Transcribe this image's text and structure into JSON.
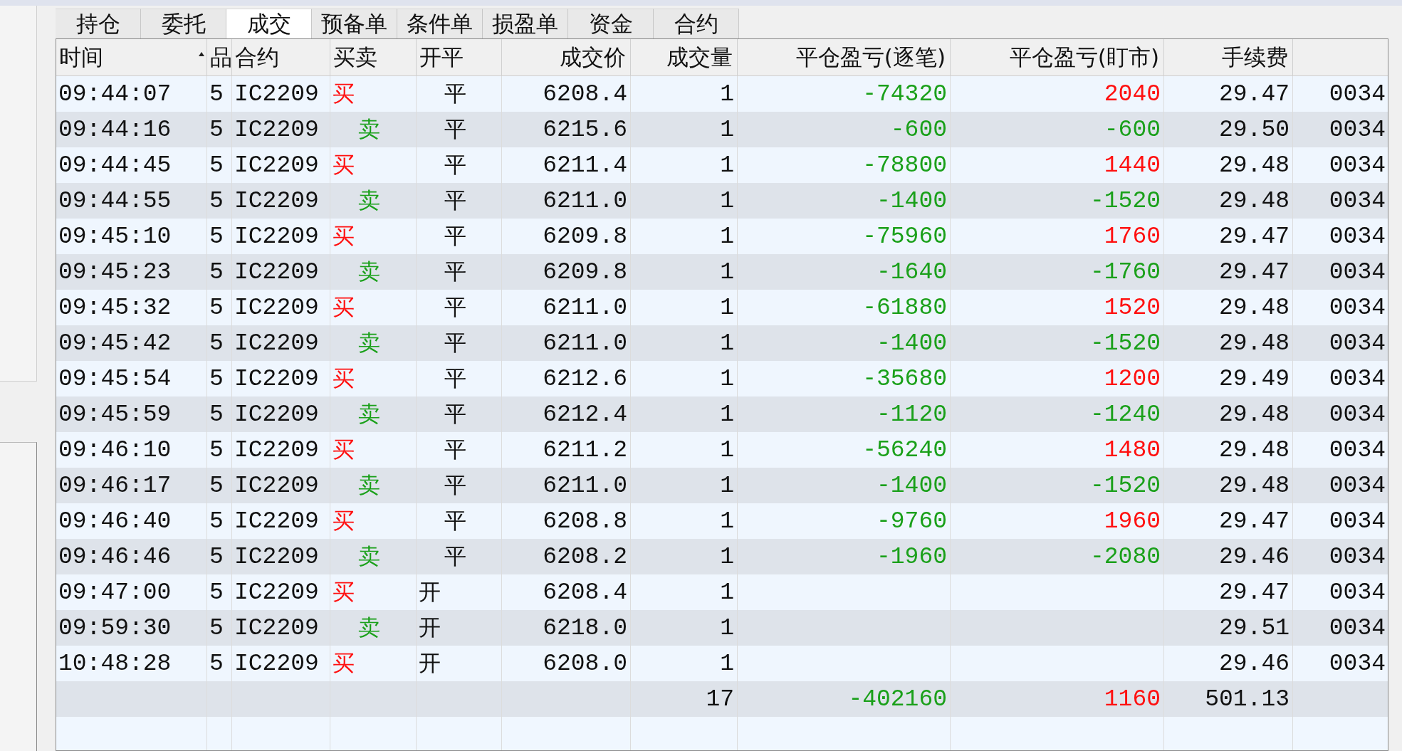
{
  "tabs": [
    {
      "label": "持仓",
      "selected": false
    },
    {
      "label": "委托",
      "selected": false
    },
    {
      "label": "成交",
      "selected": true
    },
    {
      "label": "预备单",
      "selected": false
    },
    {
      "label": "条件单",
      "selected": false
    },
    {
      "label": "损盈单",
      "selected": false
    },
    {
      "label": "资金",
      "selected": false
    },
    {
      "label": "合约",
      "selected": false
    }
  ],
  "table": {
    "columns": [
      {
        "label": "时间",
        "sorted": true
      },
      {
        "label": "品",
        "sorted": false
      },
      {
        "label": "合约",
        "sorted": false
      },
      {
        "label": "买卖",
        "sorted": false
      },
      {
        "label": "开平",
        "sorted": false
      },
      {
        "label": "成交价",
        "sorted": false
      },
      {
        "label": "成交量",
        "sorted": false
      },
      {
        "label": "平仓盈亏(逐笔)",
        "sorted": false
      },
      {
        "label": "平仓盈亏(盯市)",
        "sorted": false
      },
      {
        "label": "手续费",
        "sorted": false
      }
    ],
    "rows": [
      {
        "time": "09:44:07",
        "column_2": "5",
        "contract": "IC2209",
        "side": {
          "kind": "buy",
          "text": "买"
        },
        "open_close": {
          "kind": "close",
          "text": "平"
        },
        "price": "6208.4",
        "volume": "1",
        "pnl_trade": {
          "kind": "loss",
          "text": "-74320"
        },
        "pnl_mark": {
          "kind": "profit",
          "text": "2040"
        },
        "fee": "29.47",
        "column_11": "0034"
      },
      {
        "time": "09:44:16",
        "column_2": "5",
        "contract": "IC2209",
        "side": {
          "kind": "sell",
          "text": "卖"
        },
        "open_close": {
          "kind": "close",
          "text": "平"
        },
        "price": "6215.6",
        "volume": "1",
        "pnl_trade": {
          "kind": "loss",
          "text": "-600"
        },
        "pnl_mark": {
          "kind": "loss",
          "text": "-600"
        },
        "fee": "29.50",
        "column_11": "0034"
      },
      {
        "time": "09:44:45",
        "column_2": "5",
        "contract": "IC2209",
        "side": {
          "kind": "buy",
          "text": "买"
        },
        "open_close": {
          "kind": "close",
          "text": "平"
        },
        "price": "6211.4",
        "volume": "1",
        "pnl_trade": {
          "kind": "loss",
          "text": "-78800"
        },
        "pnl_mark": {
          "kind": "profit",
          "text": "1440"
        },
        "fee": "29.48",
        "column_11": "0034"
      },
      {
        "time": "09:44:55",
        "column_2": "5",
        "contract": "IC2209",
        "side": {
          "kind": "sell",
          "text": "卖"
        },
        "open_close": {
          "kind": "close",
          "text": "平"
        },
        "price": "6211.0",
        "volume": "1",
        "pnl_trade": {
          "kind": "loss",
          "text": "-1400"
        },
        "pnl_mark": {
          "kind": "loss",
          "text": "-1520"
        },
        "fee": "29.48",
        "column_11": "0034"
      },
      {
        "time": "09:45:10",
        "column_2": "5",
        "contract": "IC2209",
        "side": {
          "kind": "buy",
          "text": "买"
        },
        "open_close": {
          "kind": "close",
          "text": "平"
        },
        "price": "6209.8",
        "volume": "1",
        "pnl_trade": {
          "kind": "loss",
          "text": "-75960"
        },
        "pnl_mark": {
          "kind": "profit",
          "text": "1760"
        },
        "fee": "29.47",
        "column_11": "0034"
      },
      {
        "time": "09:45:23",
        "column_2": "5",
        "contract": "IC2209",
        "side": {
          "kind": "sell",
          "text": "卖"
        },
        "open_close": {
          "kind": "close",
          "text": "平"
        },
        "price": "6209.8",
        "volume": "1",
        "pnl_trade": {
          "kind": "loss",
          "text": "-1640"
        },
        "pnl_mark": {
          "kind": "loss",
          "text": "-1760"
        },
        "fee": "29.47",
        "column_11": "0034"
      },
      {
        "time": "09:45:32",
        "column_2": "5",
        "contract": "IC2209",
        "side": {
          "kind": "buy",
          "text": "买"
        },
        "open_close": {
          "kind": "close",
          "text": "平"
        },
        "price": "6211.0",
        "volume": "1",
        "pnl_trade": {
          "kind": "loss",
          "text": "-61880"
        },
        "pnl_mark": {
          "kind": "profit",
          "text": "1520"
        },
        "fee": "29.48",
        "column_11": "0034"
      },
      {
        "time": "09:45:42",
        "column_2": "5",
        "contract": "IC2209",
        "side": {
          "kind": "sell",
          "text": "卖"
        },
        "open_close": {
          "kind": "close",
          "text": "平"
        },
        "price": "6211.0",
        "volume": "1",
        "pnl_trade": {
          "kind": "loss",
          "text": "-1400"
        },
        "pnl_mark": {
          "kind": "loss",
          "text": "-1520"
        },
        "fee": "29.48",
        "column_11": "0034"
      },
      {
        "time": "09:45:54",
        "column_2": "5",
        "contract": "IC2209",
        "side": {
          "kind": "buy",
          "text": "买"
        },
        "open_close": {
          "kind": "close",
          "text": "平"
        },
        "price": "6212.6",
        "volume": "1",
        "pnl_trade": {
          "kind": "loss",
          "text": "-35680"
        },
        "pnl_mark": {
          "kind": "profit",
          "text": "1200"
        },
        "fee": "29.49",
        "column_11": "0034"
      },
      {
        "time": "09:45:59",
        "column_2": "5",
        "contract": "IC2209",
        "side": {
          "kind": "sell",
          "text": "卖"
        },
        "open_close": {
          "kind": "close",
          "text": "平"
        },
        "price": "6212.4",
        "volume": "1",
        "pnl_trade": {
          "kind": "loss",
          "text": "-1120"
        },
        "pnl_mark": {
          "kind": "loss",
          "text": "-1240"
        },
        "fee": "29.48",
        "column_11": "0034"
      },
      {
        "time": "09:46:10",
        "column_2": "5",
        "contract": "IC2209",
        "side": {
          "kind": "buy",
          "text": "买"
        },
        "open_close": {
          "kind": "close",
          "text": "平"
        },
        "price": "6211.2",
        "volume": "1",
        "pnl_trade": {
          "kind": "loss",
          "text": "-56240"
        },
        "pnl_mark": {
          "kind": "profit",
          "text": "1480"
        },
        "fee": "29.48",
        "column_11": "0034"
      },
      {
        "time": "09:46:17",
        "column_2": "5",
        "contract": "IC2209",
        "side": {
          "kind": "sell",
          "text": "卖"
        },
        "open_close": {
          "kind": "close",
          "text": "平"
        },
        "price": "6211.0",
        "volume": "1",
        "pnl_trade": {
          "kind": "loss",
          "text": "-1400"
        },
        "pnl_mark": {
          "kind": "loss",
          "text": "-1520"
        },
        "fee": "29.48",
        "column_11": "0034"
      },
      {
        "time": "09:46:40",
        "column_2": "5",
        "contract": "IC2209",
        "side": {
          "kind": "buy",
          "text": "买"
        },
        "open_close": {
          "kind": "close",
          "text": "平"
        },
        "price": "6208.8",
        "volume": "1",
        "pnl_trade": {
          "kind": "loss",
          "text": "-9760"
        },
        "pnl_mark": {
          "kind": "profit",
          "text": "1960"
        },
        "fee": "29.47",
        "column_11": "0034"
      },
      {
        "time": "09:46:46",
        "column_2": "5",
        "contract": "IC2209",
        "side": {
          "kind": "sell",
          "text": "卖"
        },
        "open_close": {
          "kind": "close",
          "text": "平"
        },
        "price": "6208.2",
        "volume": "1",
        "pnl_trade": {
          "kind": "loss",
          "text": "-1960"
        },
        "pnl_mark": {
          "kind": "loss",
          "text": "-2080"
        },
        "fee": "29.46",
        "column_11": "0034"
      },
      {
        "time": "09:47:00",
        "column_2": "5",
        "contract": "IC2209",
        "side": {
          "kind": "buy",
          "text": "买"
        },
        "open_close": {
          "kind": "open",
          "text": "开"
        },
        "price": "6208.4",
        "volume": "1",
        "fee": "29.47",
        "column_11": "0034"
      },
      {
        "time": "09:59:30",
        "column_2": "5",
        "contract": "IC2209",
        "side": {
          "kind": "sell",
          "text": "卖"
        },
        "open_close": {
          "kind": "open",
          "text": "开"
        },
        "price": "6218.0",
        "volume": "1",
        "fee": "29.51",
        "column_11": "0034"
      },
      {
        "time": "10:48:28",
        "column_2": "5",
        "contract": "IC2209",
        "side": {
          "kind": "buy",
          "text": "买"
        },
        "open_close": {
          "kind": "open",
          "text": "开"
        },
        "price": "6208.0",
        "volume": "1",
        "fee": "29.46",
        "column_11": "0034"
      }
    ],
    "totals": {
      "volume": "17",
      "pnl_trade": {
        "kind": "loss",
        "text": "-402160"
      },
      "pnl_mark": {
        "kind": "profit",
        "text": "1160"
      },
      "fee": "501.13"
    }
  }
}
